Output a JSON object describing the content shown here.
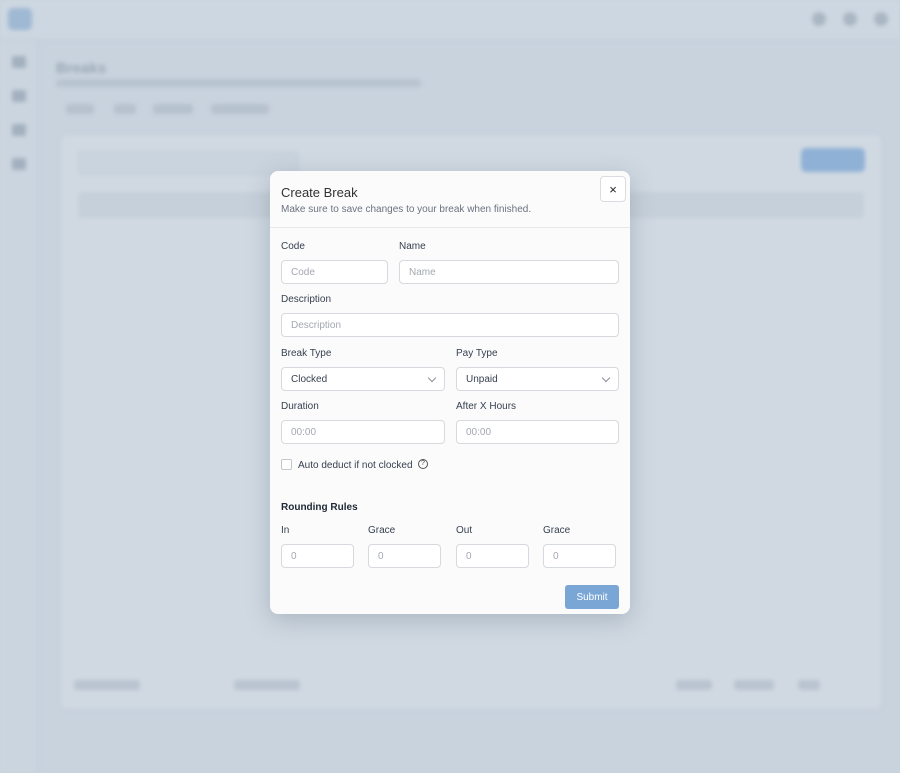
{
  "background": {
    "page_title": "Breaks"
  },
  "modal": {
    "title": "Create Break",
    "subtitle": "Make sure to save changes to your break when finished.",
    "close_icon": "×",
    "fields": {
      "code": {
        "label": "Code",
        "placeholder": "Code"
      },
      "name": {
        "label": "Name",
        "placeholder": "Name"
      },
      "description": {
        "label": "Description",
        "placeholder": "Description"
      },
      "break_type": {
        "label": "Break Type",
        "value": "Clocked"
      },
      "pay_type": {
        "label": "Pay Type",
        "value": "Unpaid"
      },
      "duration": {
        "label": "Duration",
        "placeholder": "00:00"
      },
      "after_x_hours": {
        "label": "After X Hours",
        "placeholder": "00:00"
      }
    },
    "auto_deduct": {
      "label": "Auto deduct if not clocked",
      "checked": false,
      "help_icon": "?"
    },
    "rounding": {
      "title": "Rounding Rules",
      "in": {
        "label": "In",
        "placeholder": "0"
      },
      "in_grace": {
        "label": "Grace",
        "placeholder": "0"
      },
      "out": {
        "label": "Out",
        "placeholder": "0"
      },
      "out_grace": {
        "label": "Grace",
        "placeholder": "0"
      }
    },
    "submit_label": "Submit"
  },
  "colors": {
    "accent": "#7aa6d6",
    "overlay": "#c9d3de"
  }
}
